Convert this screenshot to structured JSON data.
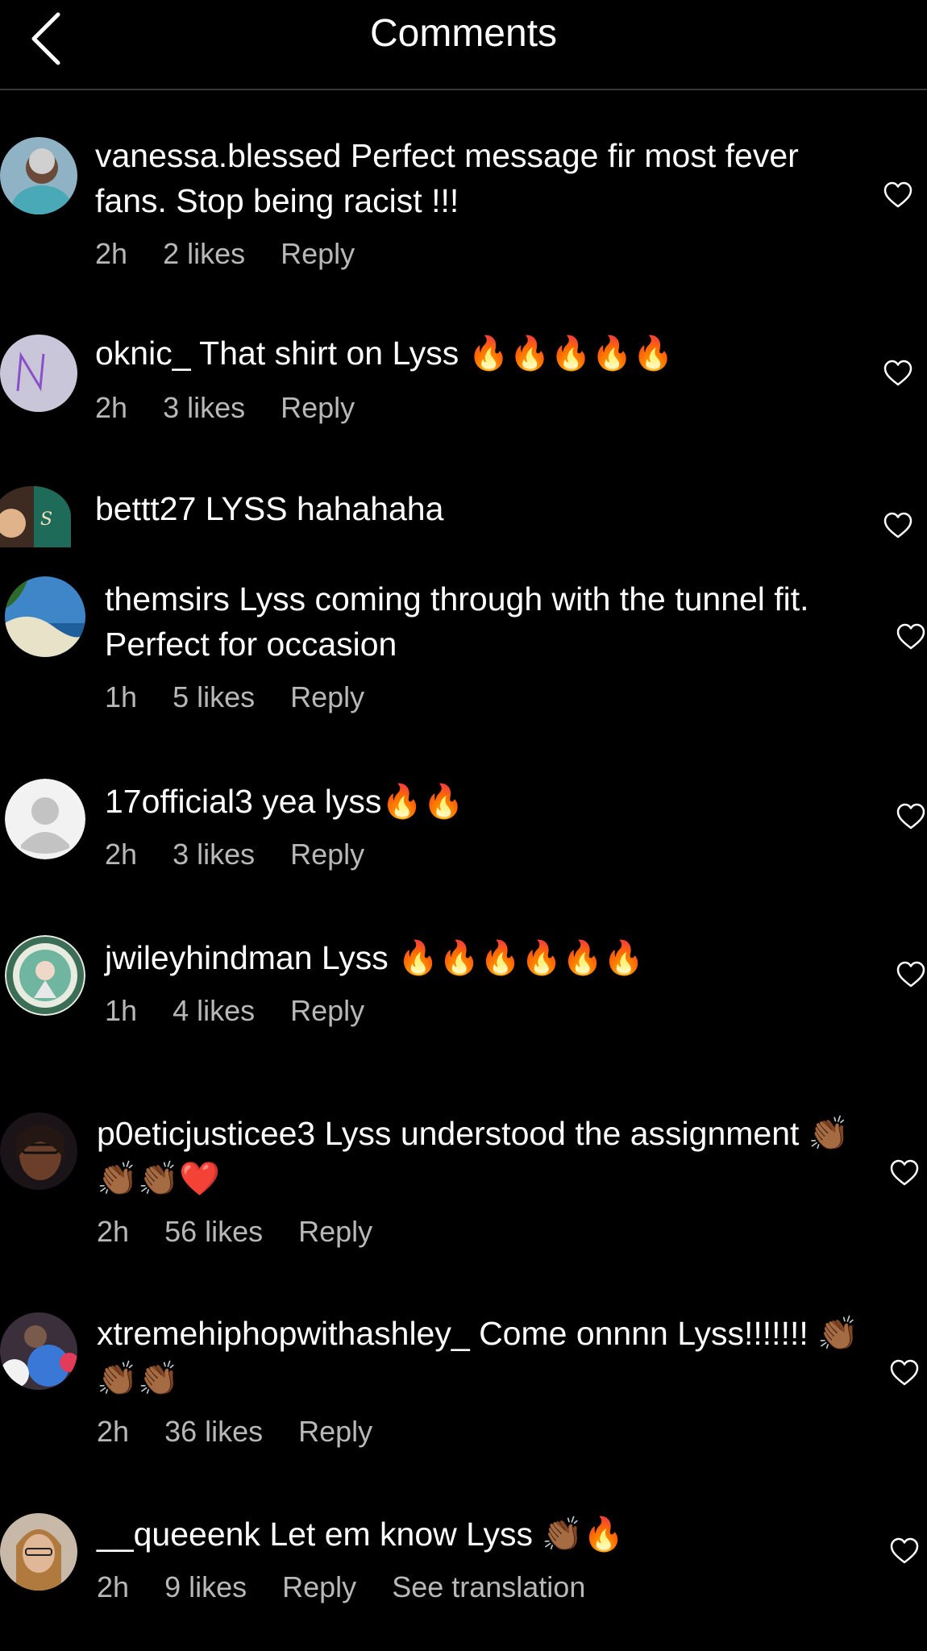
{
  "header": {
    "title": "Comments"
  },
  "comments": [
    {
      "username": "vanessa.blessed",
      "text": "Perfect message fir most fever fans. Stop being racist !!!",
      "time": "2h",
      "likes": "2 likes",
      "reply": "Reply"
    },
    {
      "username": "oknic_",
      "text": "That shirt on Lyss 🔥🔥🔥🔥🔥",
      "time": "2h",
      "likes": "3 likes",
      "reply": "Reply"
    },
    {
      "username": "bettt27",
      "text": "LYSS hahahaha"
    },
    {
      "username": "themsirs",
      "text": "Lyss coming through with the tunnel fit. Perfect for occasion",
      "time": "1h",
      "likes": "5 likes",
      "reply": "Reply"
    },
    {
      "username": "17official3",
      "text": "yea lyss🔥🔥",
      "time": "2h",
      "likes": "3 likes",
      "reply": "Reply"
    },
    {
      "username": "jwileyhindman",
      "text": "Lyss 🔥🔥🔥🔥🔥🔥",
      "time": "1h",
      "likes": "4 likes",
      "reply": "Reply"
    },
    {
      "username": "p0eticjusticee3",
      "text": "Lyss understood the assignment 👏🏾👏🏾👏🏾❤️",
      "time": "2h",
      "likes": "56 likes",
      "reply": "Reply"
    },
    {
      "username": "xtremehiphopwithashley_",
      "text": "Come onnnn Lyss!!!!!!! 👏🏾👏🏾👏🏾",
      "time": "2h",
      "likes": "36 likes",
      "reply": "Reply"
    },
    {
      "username": "__queeenk",
      "text": "Let em know Lyss 👏🏾🔥",
      "time": "2h",
      "likes": "9 likes",
      "reply": "Reply",
      "translation": "See translation"
    }
  ],
  "icons": {
    "back": "chevron-left-icon",
    "like": "heart-outline-icon"
  },
  "colors": {
    "background": "#000000",
    "text": "#ffffff",
    "meta": "#b8b8b8",
    "divider": "#3a3a3a"
  }
}
